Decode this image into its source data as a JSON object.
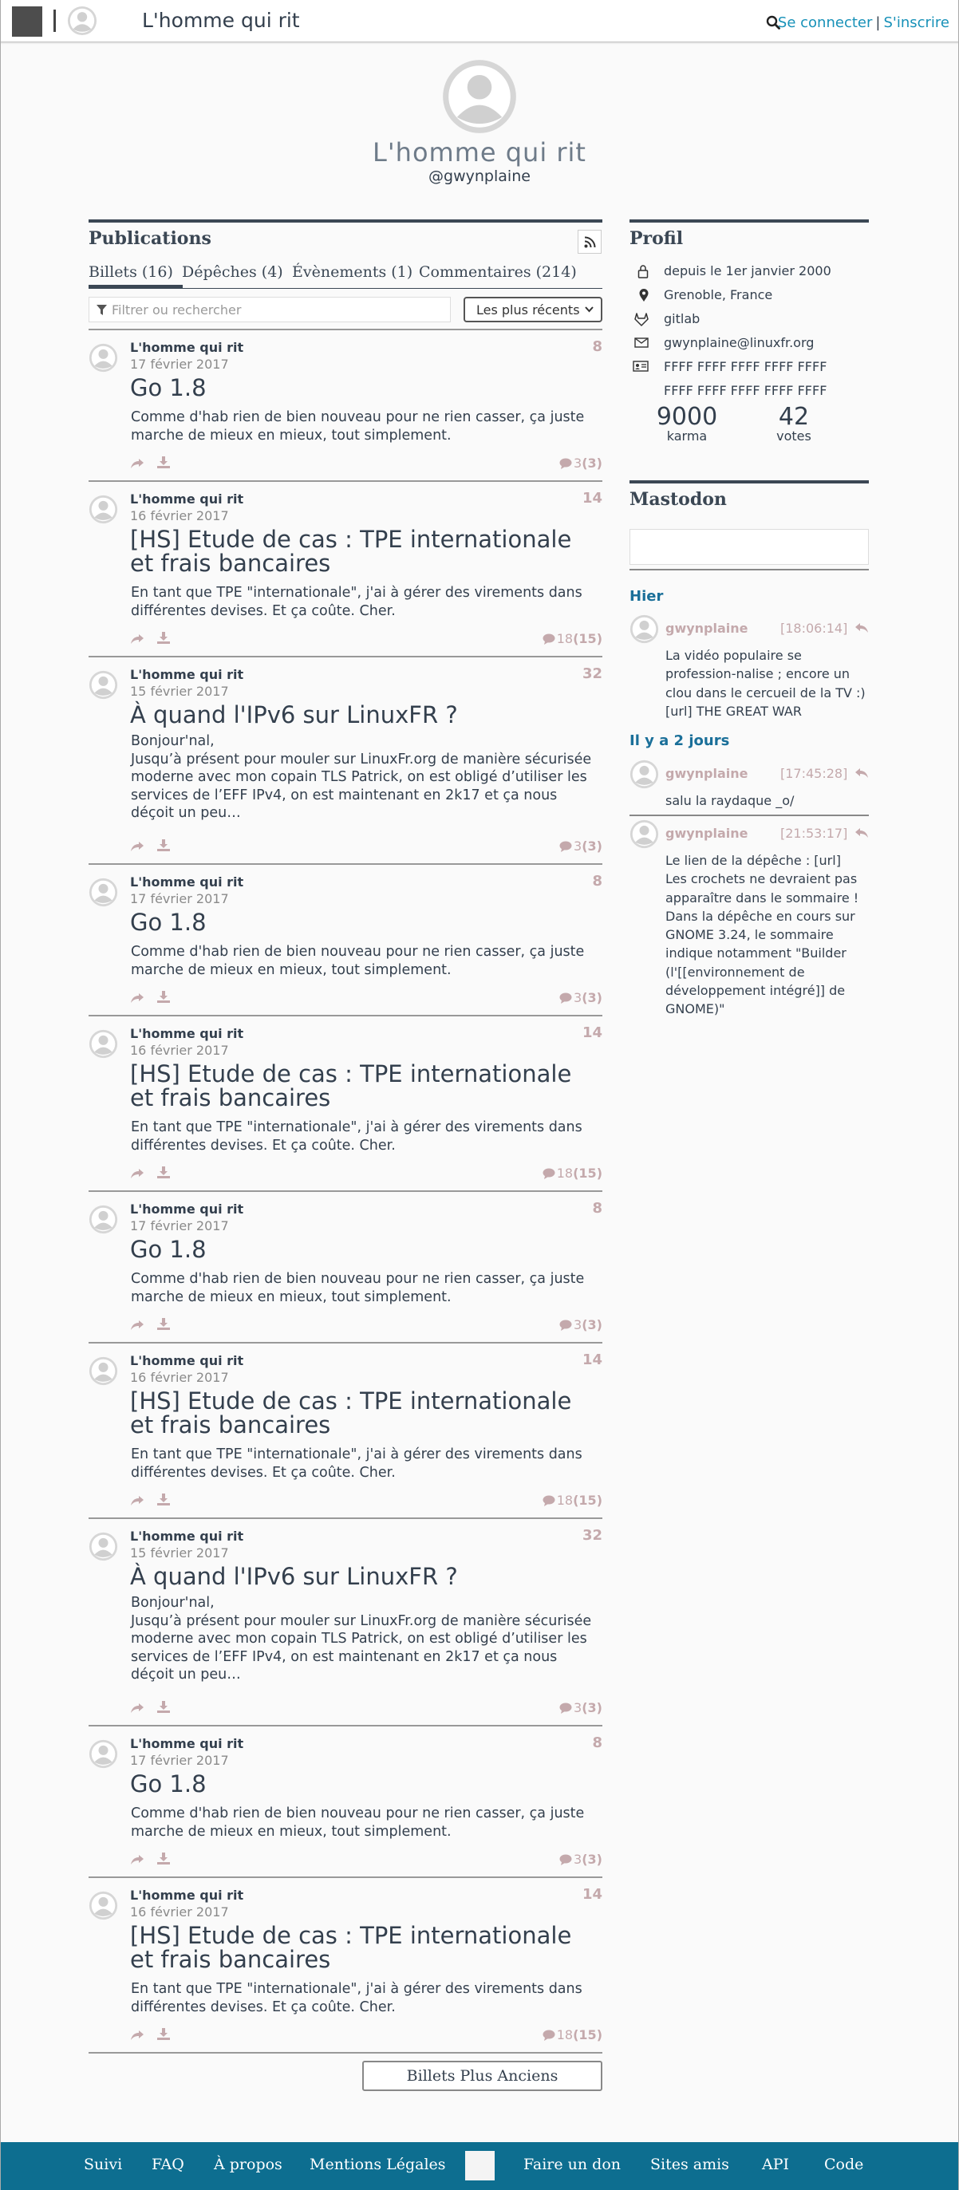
{
  "header": {
    "site_title": "L'homme qui rit",
    "login_label": "Se connecter",
    "separator": "|",
    "signup_label": "S'inscrire"
  },
  "profile_head": {
    "name": "L'homme qui rit",
    "handle": "@gwynplaine"
  },
  "publications": {
    "title": "Publications",
    "tabs": [
      {
        "label": "Billets (16)"
      },
      {
        "label": "Dépêches (4)"
      },
      {
        "label": "Évènements (1)"
      },
      {
        "label": "Commentaires (214)"
      }
    ],
    "active_tab": "Billets (16)",
    "filter_placeholder": "Filtrer ou rechercher",
    "sort_value": "Les plus récents",
    "articles": [
      {
        "author": "L'homme qui rit",
        "date": "17 février 2017",
        "score": "8",
        "title": "Go 1.8",
        "body": "Comme d'hab rien de bien nouveau pour ne rien casser, ça juste marche de mieux en mieux, tout simplement.",
        "comments": "3",
        "new_comments": "(3)"
      },
      {
        "author": "L'homme qui rit",
        "date": "16 février 2017",
        "score": "14",
        "title": "[HS] Etude de cas : TPE internationale et frais bancaires",
        "body": "En tant que TPE \"internationale\", j'ai à gérer des virements dans différentes devises. Et ça coûte. Cher.",
        "comments": "18",
        "new_comments": "(15)"
      },
      {
        "author": "L'homme qui rit",
        "date": "15 février 2017",
        "score": "32",
        "title": "À quand l'IPv6 sur LinuxFR ?",
        "body": "Bonjour'nal,\nJusqu’à présent pour mouler sur LinuxFr.org de manière sécurisée moderne avec mon copain TLS Patrick, on est obligé d’utiliser les services de l’EFF IPv4, on est maintenant en 2k17 et ça nous déçoit un peu…",
        "comments": "3",
        "new_comments": "(3)"
      },
      {
        "author": "L'homme qui rit",
        "date": "17 février 2017",
        "score": "8",
        "title": "Go 1.8",
        "body": "Comme d'hab rien de bien nouveau pour ne rien casser, ça juste marche de mieux en mieux, tout simplement.",
        "comments": "3",
        "new_comments": "(3)"
      },
      {
        "author": "L'homme qui rit",
        "date": "16 février 2017",
        "score": "14",
        "title": "[HS] Etude de cas : TPE internationale et frais bancaires",
        "body": "En tant que TPE \"internationale\", j'ai à gérer des virements dans différentes devises. Et ça coûte. Cher.",
        "comments": "18",
        "new_comments": "(15)"
      },
      {
        "author": "L'homme qui rit",
        "date": "17 février 2017",
        "score": "8",
        "title": "Go 1.8",
        "body": "Comme d'hab rien de bien nouveau pour ne rien casser, ça juste marche de mieux en mieux, tout simplement.",
        "comments": "3",
        "new_comments": "(3)"
      },
      {
        "author": "L'homme qui rit",
        "date": "16 février 2017",
        "score": "14",
        "title": "[HS] Etude de cas : TPE internationale et frais bancaires",
        "body": "En tant que TPE \"internationale\", j'ai à gérer des virements dans différentes devises. Et ça coûte. Cher.",
        "comments": "18",
        "new_comments": "(15)"
      },
      {
        "author": "L'homme qui rit",
        "date": "15 février 2017",
        "score": "32",
        "title": "À quand l'IPv6 sur LinuxFR ?",
        "body": "Bonjour'nal,\nJusqu’à présent pour mouler sur LinuxFr.org de manière sécurisée moderne avec mon copain TLS Patrick, on est obligé d’utiliser les services de l’EFF IPv4, on est maintenant en 2k17 et ça nous déçoit un peu…",
        "comments": "3",
        "new_comments": "(3)"
      },
      {
        "author": "L'homme qui rit",
        "date": "17 février 2017",
        "score": "8",
        "title": "Go 1.8",
        "body": "Comme d'hab rien de bien nouveau pour ne rien casser, ça juste marche de mieux en mieux, tout simplement.",
        "comments": "3",
        "new_comments": "(3)"
      },
      {
        "author": "L'homme qui rit",
        "date": "16 février 2017",
        "score": "14",
        "title": "[HS] Etude de cas : TPE internationale et frais bancaires",
        "body": "En tant que TPE \"internationale\", j'ai à gérer des virements dans différentes devises. Et ça coûte. Cher.",
        "comments": "18",
        "new_comments": "(15)"
      }
    ],
    "older_button": "Billets Plus Anciens"
  },
  "profil": {
    "title": "Profil",
    "items": [
      {
        "icon": "lock-icon",
        "text": "depuis le 1er janvier 2000"
      },
      {
        "icon": "map-pin-icon",
        "text": "Grenoble, France"
      },
      {
        "icon": "gitlab-icon",
        "text": "gitlab"
      },
      {
        "icon": "envelope-icon",
        "text": "gwynplaine@linuxfr.org"
      },
      {
        "icon": "id-card-icon",
        "text": "FFFF FFFF FFFF FFFF FFFF"
      },
      {
        "icon": "",
        "text": "FFFF FFFF FFFF FFFF FFFF"
      }
    ],
    "karma_value": "9000",
    "karma_label": "karma",
    "votes_value": "42",
    "votes_label": "votes"
  },
  "mastodon": {
    "title": "Mastodon",
    "groups": [
      {
        "day": "Hier"
      },
      {
        "day": "Il y a 2 jours"
      }
    ],
    "toots": [
      {
        "user": "gwynplaine",
        "time": "[18:06:14]",
        "text": "La vidéo populaire se profession-nalise ; encore un clou dans le cercueil de la TV :)\n[url] THE GREAT WAR"
      },
      {
        "user": "gwynplaine",
        "time": "[17:45:28]",
        "text": "salu la raydaque _o/"
      },
      {
        "user": "gwynplaine",
        "time": "[21:53:17]",
        "text": "Le lien de la dépêche : [url]\nLes crochets ne devraient pas apparaître dans le sommaire ! Dans la dépêche en cours sur GNOME 3.24, le sommaire indique notamment \"Builder (l'[[environnement de développement intégré]] de GNOME)\""
      }
    ]
  },
  "footer": {
    "links": [
      "Suivi",
      "FAQ",
      "À propos",
      "Mentions Légales",
      "Faire un don",
      "Sites amis",
      "API",
      "Code"
    ]
  },
  "colors": {
    "accent": "#1791b8",
    "footer_bg": "#0d6e90",
    "muted_pink": "#c4a9ac",
    "text": "#333f4d"
  }
}
